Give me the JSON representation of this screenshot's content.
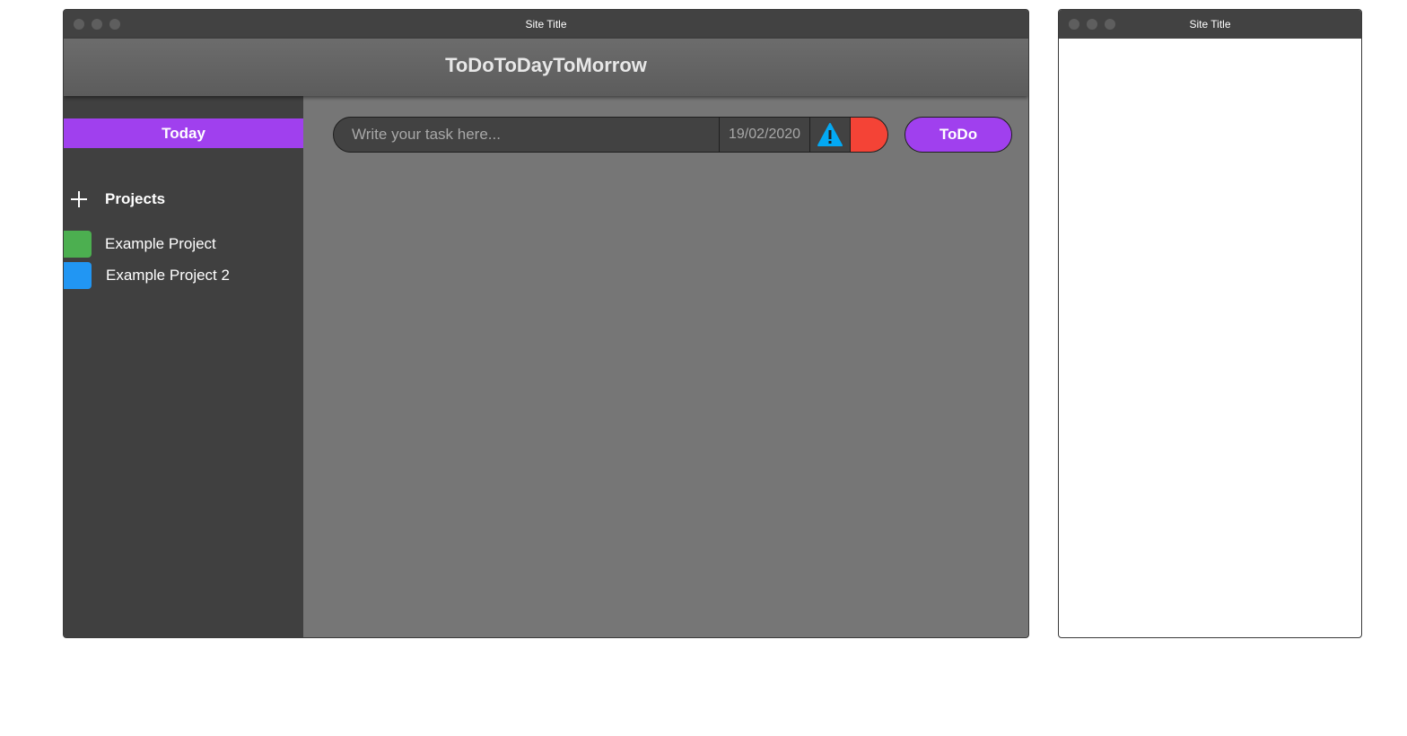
{
  "main_window": {
    "title": "Site Title",
    "app_title": "ToDoToDayToMorrow",
    "sidebar": {
      "today_label": "Today",
      "projects_label": "Projects",
      "projects": [
        {
          "label": "Example Project",
          "color": "#4caf50"
        },
        {
          "label": "Example Project 2",
          "color": "#2196f3"
        }
      ]
    },
    "task_form": {
      "placeholder": "Write your task here...",
      "date": "19/02/2020",
      "priority_icon": "warning-icon",
      "priority_icon_color": "#03a9f4",
      "color_value": "#f44336",
      "submit_label": "ToDo"
    }
  },
  "secondary_window": {
    "title": "Site Title"
  },
  "colors": {
    "accent": "#a040ee",
    "titlebar": "#424242",
    "sidebar": "#404040",
    "content": "#767676"
  }
}
